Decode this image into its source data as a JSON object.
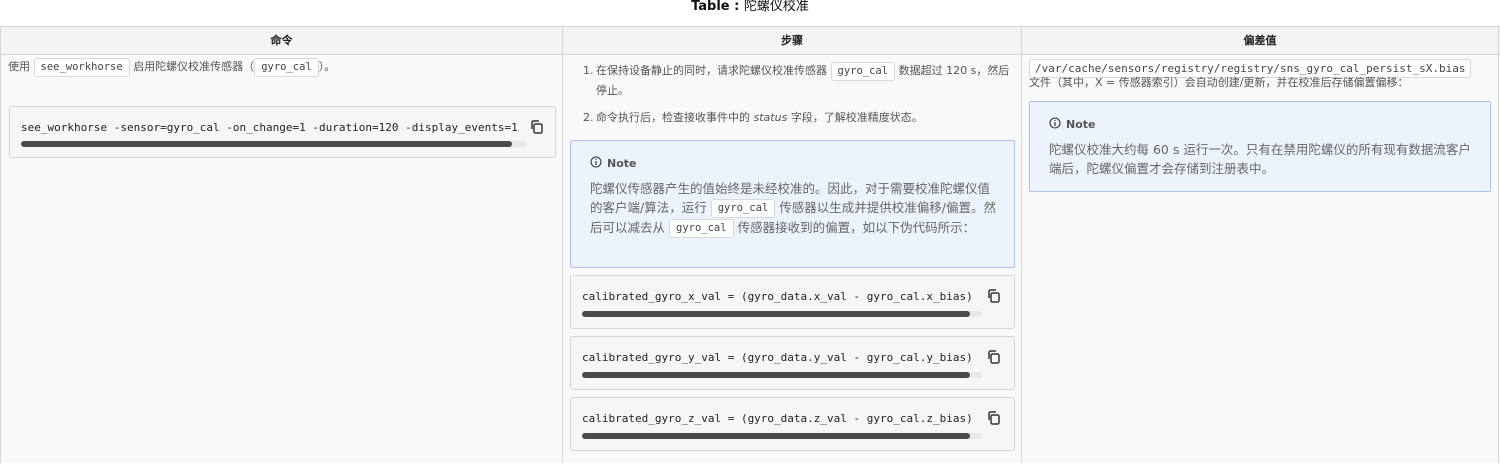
{
  "caption": {
    "label": "Table :",
    "text": "陀螺仪校准"
  },
  "headers": [
    "命令",
    "步骤",
    "偏差值"
  ],
  "col1": {
    "intro_pre": "使用",
    "intro_code1": "see_workhorse",
    "intro_mid": "启用陀螺仪校准传感器（",
    "intro_code2": "gyro_cal",
    "intro_post": "）。",
    "command": "see_workhorse -sensor=gyro_cal -on_change=1 -duration=120 -display_events=1",
    "scroll_fraction": 0.97
  },
  "col2": {
    "step1_num": "1.",
    "step1_pre": "在保持设备静止的同时，请求陀螺仪校准传感器",
    "step1_code": "gyro_cal",
    "step1_post": "数据超过 120 s，然后停止。",
    "step2_num": "2.",
    "step2_pre": "命令执行后，检查接收事件中的",
    "step2_em": "status",
    "step2_post": "字段，了解校准精度状态。",
    "note_title": "Note",
    "note_p1": "陀螺仪传感器产生的值始终是未经校准的。因此，对于需要校准陀螺仪值的客户端/算法，运行",
    "note_code1": "gyro_cal",
    "note_p2": "传感器以生成并提供校准偏移/偏置。然后可以减去从",
    "note_code2": "gyro_cal",
    "note_p3": "传感器接收到的偏置，如以下伪代码所示：",
    "code_lines": [
      "calibrated_gyro_x_val = (gyro_data.x_val - gyro_cal.x_bias)",
      "calibrated_gyro_y_val = (gyro_data.y_val - gyro_cal.y_bias)",
      "calibrated_gyro_z_val = (gyro_data.z_val - gyro_cal.z_bias)"
    ],
    "scroll_fraction": 0.97
  },
  "col3": {
    "path": "/var/cache/sensors/registry/registry/sns_gyro_cal_persist_sX.bias",
    "desc": "文件（其中，X = 传感器索引）会自动创建/更新，并在校准后存储偏置偏移：",
    "note_title": "Note",
    "note_body": "陀螺仪校准大约每 60 s 运行一次。只有在禁用陀螺仪的所有现有数据流客户端后，陀螺仪偏置才会存储到注册表中。"
  },
  "icons": {
    "copy": "copy-icon",
    "info": "info-icon"
  }
}
